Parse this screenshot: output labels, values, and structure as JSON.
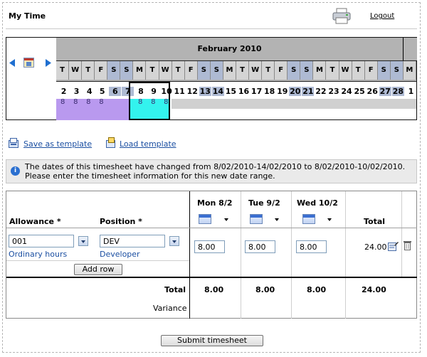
{
  "header": {
    "title": "My Time",
    "logout_label": "Logout"
  },
  "calendar": {
    "month_label": "February 2010",
    "weekday_letters": [
      "T",
      "W",
      "T",
      "F",
      "S",
      "S",
      "M",
      "T",
      "W",
      "T",
      "F",
      "S",
      "S",
      "M",
      "T",
      "W",
      "T",
      "F",
      "S",
      "S",
      "M",
      "T",
      "W",
      "T",
      "F",
      "S",
      "S",
      "M"
    ],
    "dates": [
      "2",
      "3",
      "4",
      "5",
      "6",
      "7",
      "8",
      "9",
      "10",
      "11",
      "12",
      "13",
      "14",
      "15",
      "16",
      "17",
      "18",
      "19",
      "20",
      "21",
      "22",
      "23",
      "24",
      "25",
      "26",
      "27",
      "28",
      "1"
    ],
    "hours_filled": [
      "8",
      "8",
      "8",
      "8"
    ],
    "hours_selected": [
      "8",
      "8",
      "8"
    ]
  },
  "toolbar": {
    "save_template_label": "Save as template",
    "load_template_label": "Load template"
  },
  "info": {
    "message_line1": "The dates of this timesheet have changed from 8/02/2010-14/02/2010 to 8/02/2010-10/02/2010.",
    "message_line2": "Please enter the timesheet information for this new date range."
  },
  "timesheet": {
    "allowance_header": "Allowance *",
    "position_header": "Position *",
    "day_headers": [
      "Mon 8/2",
      "Tue 9/2",
      "Wed 10/2"
    ],
    "total_header": "Total",
    "row": {
      "allowance_code": "001",
      "allowance_name": "Ordinary hours",
      "position_code": "DEV",
      "position_name": "Developer",
      "hours": [
        "8.00",
        "8.00",
        "8.00"
      ],
      "row_total": "24.00"
    },
    "add_row_label": "Add row",
    "total_label": "Total",
    "variance_label": "Variance",
    "day_totals": [
      "8.00",
      "8.00",
      "8.00"
    ],
    "grand_total": "24.00"
  },
  "submit_label": "Submit timesheet",
  "colors": {
    "link": "#1a4ea1",
    "weekend": "#aebad3",
    "filled_hours": "#b999ef",
    "selected_hours": "#33f3ee"
  }
}
